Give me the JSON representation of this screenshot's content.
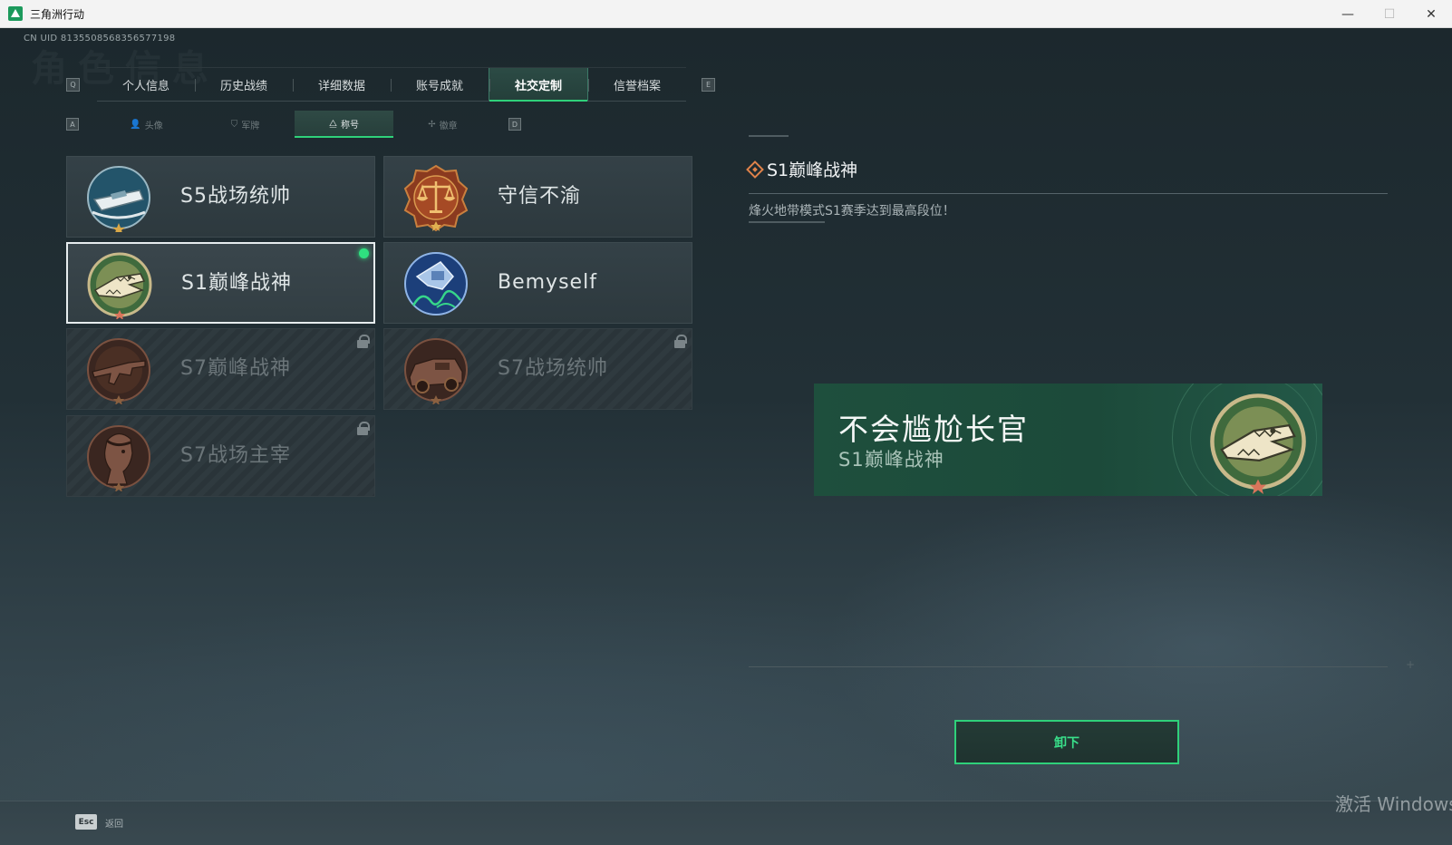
{
  "window": {
    "title": "三角洲行动",
    "minimize": "—",
    "maximize": "☐",
    "close": "✕"
  },
  "uid": "CN UID 8135508568356577198",
  "watermark": "角色信息",
  "main_tabs": {
    "left_key": "Q",
    "right_key": "E",
    "items": [
      {
        "label": "个人信息",
        "active": false
      },
      {
        "label": "历史战绩",
        "active": false
      },
      {
        "label": "详细数据",
        "active": false
      },
      {
        "label": "账号成就",
        "active": false
      },
      {
        "label": "社交定制",
        "active": true
      },
      {
        "label": "信誉档案",
        "active": false
      }
    ]
  },
  "sub_tabs": {
    "left_key": "A",
    "right_key": "D",
    "items": [
      {
        "label": "头像",
        "icon": "person-icon",
        "glyph": "👤",
        "active": false
      },
      {
        "label": "军牌",
        "icon": "dogtag-icon",
        "glyph": "⛉",
        "active": false
      },
      {
        "label": "称号",
        "icon": "title-icon",
        "glyph": "⧋",
        "active": true
      },
      {
        "label": "徽章",
        "icon": "emblem-icon",
        "glyph": "✢",
        "active": false
      }
    ]
  },
  "titles": [
    {
      "name": "S5战场统帅",
      "badge": "speedboat-badge",
      "equipped": false,
      "locked": false
    },
    {
      "name": "守信不渝",
      "badge": "scales-badge",
      "equipped": false,
      "locked": false
    },
    {
      "name": "S1巅峰战神",
      "badge": "crocodile-badge",
      "equipped": true,
      "locked": false
    },
    {
      "name": "Bemyself",
      "badge": "signature-badge",
      "equipped": false,
      "locked": false
    },
    {
      "name": "S7巅峰战神",
      "badge": "rifle-badge",
      "equipped": false,
      "locked": true
    },
    {
      "name": "S7战场统帅",
      "badge": "vehicle-badge",
      "equipped": false,
      "locked": true
    },
    {
      "name": "S7战场主宰",
      "badge": "operator-badge",
      "equipped": false,
      "locked": true
    }
  ],
  "detail": {
    "title": "S1巅峰战神",
    "description": "烽火地带模式S1赛季达到最高段位！"
  },
  "nameplate": {
    "player_name": "不会尴尬长官",
    "title": "S1巅峰战神"
  },
  "unequip_button": "卸下",
  "bottom": {
    "esc_key": "Esc",
    "esc_label": "返回"
  },
  "os_watermark": "激活 Windows",
  "colors": {
    "accent": "#2fd17a",
    "detail_diamond": "#e0834a",
    "plate_bg": "#1e4f3d"
  }
}
